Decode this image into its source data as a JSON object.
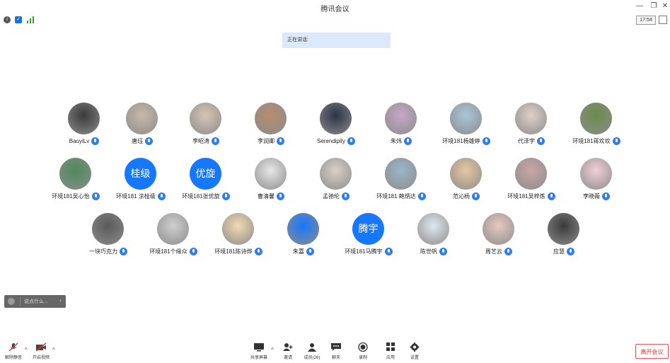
{
  "window": {
    "title": "腾讯会议"
  },
  "status": {
    "time": "17:54"
  },
  "speaking": {
    "label": "正在讲话:"
  },
  "toast": {
    "text": "说点什么..."
  },
  "participants": [
    {
      "name": "BaoyiLv",
      "avatar": "photo"
    },
    {
      "name": "唐珏",
      "avatar": "photo"
    },
    {
      "name": "李昭涛",
      "avatar": "photo"
    },
    {
      "name": "李润卿",
      "avatar": "photo"
    },
    {
      "name": "Serendipity",
      "avatar": "photo"
    },
    {
      "name": "朱炜",
      "avatar": "photo"
    },
    {
      "name": "环境181杨雄婷",
      "avatar": "photo"
    },
    {
      "name": "代泽宇",
      "avatar": "photo"
    },
    {
      "name": "环境181蒋欢欢",
      "avatar": "photo"
    },
    {
      "name": "环境181吴心怡",
      "avatar": "photo"
    },
    {
      "name": "环境181 涂桂级",
      "avatar": "text",
      "initials": "桂级"
    },
    {
      "name": "环境181张优旋",
      "avatar": "text",
      "initials": "优旋"
    },
    {
      "name": "曹清馨",
      "avatar": "photo"
    },
    {
      "name": "孟驰伦",
      "avatar": "photo"
    },
    {
      "name": "环境181 鲍炳达",
      "avatar": "photo"
    },
    {
      "name": "范沁杨",
      "avatar": "photo"
    },
    {
      "name": "环境181吴梓炼",
      "avatar": "photo"
    },
    {
      "name": "李晓薇",
      "avatar": "photo"
    },
    {
      "name": "一块巧克力",
      "avatar": "photo"
    },
    {
      "name": "环境181个缘众",
      "avatar": "photo"
    },
    {
      "name": "环境181陈诗烨",
      "avatar": "photo"
    },
    {
      "name": "朱嘉",
      "avatar": "photo"
    },
    {
      "name": "环境181马腾宇",
      "avatar": "text",
      "initials": "腾宇"
    },
    {
      "name": "陈世帆",
      "avatar": "photo"
    },
    {
      "name": "周艺云",
      "avatar": "photo"
    },
    {
      "name": "应慧",
      "avatar": "photo"
    }
  ],
  "toolbar": {
    "unmute": "解除静音",
    "start_video": "开启视频",
    "share": "共享屏幕",
    "invite": "邀请",
    "members": "成员(26)",
    "chat": "聊天",
    "record": "录制",
    "apps": "应用",
    "settings": "设置",
    "leave": "离开会议"
  },
  "colors": {
    "accent": "#1677ff",
    "leave": "#e33333",
    "speaking_bg": "#dce9fb"
  }
}
